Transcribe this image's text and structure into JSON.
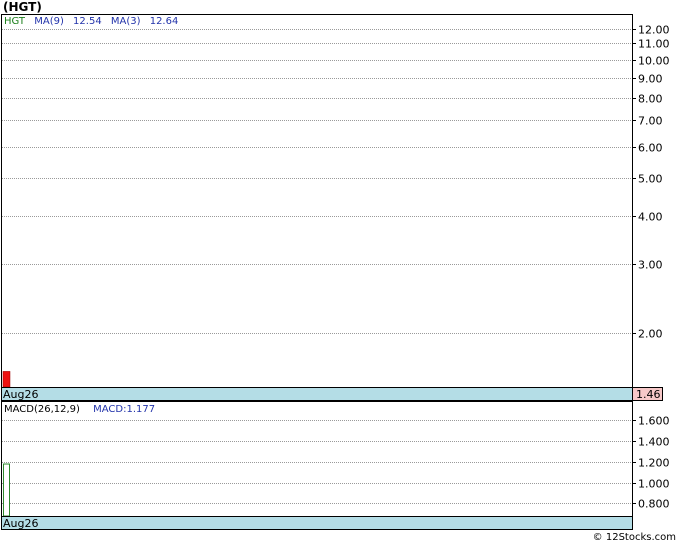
{
  "title": "(HGT)",
  "colors": {
    "grid": "#9a9a9a",
    "axis_bg": "#b4dde6",
    "price_bar": "#ee1111",
    "macd_bar": "#2e8b2e",
    "price_tag_bg": "#f6c8c8",
    "legend_ticker": "#1a7f1a",
    "legend_ma": "#2233aa"
  },
  "chart_data": [
    {
      "type": "bar",
      "name": "price-panel",
      "legend": {
        "ticker": "HGT",
        "ma9_label": "MA(9)",
        "ma9_value": "12.54",
        "ma3_label": "MA(3)",
        "ma3_value": "12.64"
      },
      "y_scale": "log",
      "ylim": [
        1.46,
        13.0
      ],
      "yticks": [
        12.0,
        11.0,
        10.0,
        9.0,
        8.0,
        7.0,
        6.0,
        5.0,
        4.0,
        3.0,
        2.0
      ],
      "ytick_labels": [
        "12.00",
        "11.00",
        "10.00",
        "9.00",
        "8.00",
        "7.00",
        "6.00",
        "5.00",
        "4.00",
        "3.00",
        "2.00"
      ],
      "x": [
        "Aug26"
      ],
      "values": [
        1.6
      ],
      "last_price_label": "1.46",
      "x_axis_label": "Aug26"
    },
    {
      "type": "bar",
      "name": "macd-panel",
      "legend": {
        "params": "MACD(26,12,9)",
        "macd_text": "MACD:1.177"
      },
      "ylim": [
        0.68,
        1.77
      ],
      "yticks": [
        1.6,
        1.4,
        1.2,
        1.0,
        0.8
      ],
      "ytick_labels": [
        "1.600",
        "1.400",
        "1.200",
        "1.000",
        "0.800"
      ],
      "x": [
        "Aug26"
      ],
      "values": [
        1.177
      ],
      "x_axis_label": "Aug26"
    }
  ],
  "footer": "© 12Stocks.com"
}
